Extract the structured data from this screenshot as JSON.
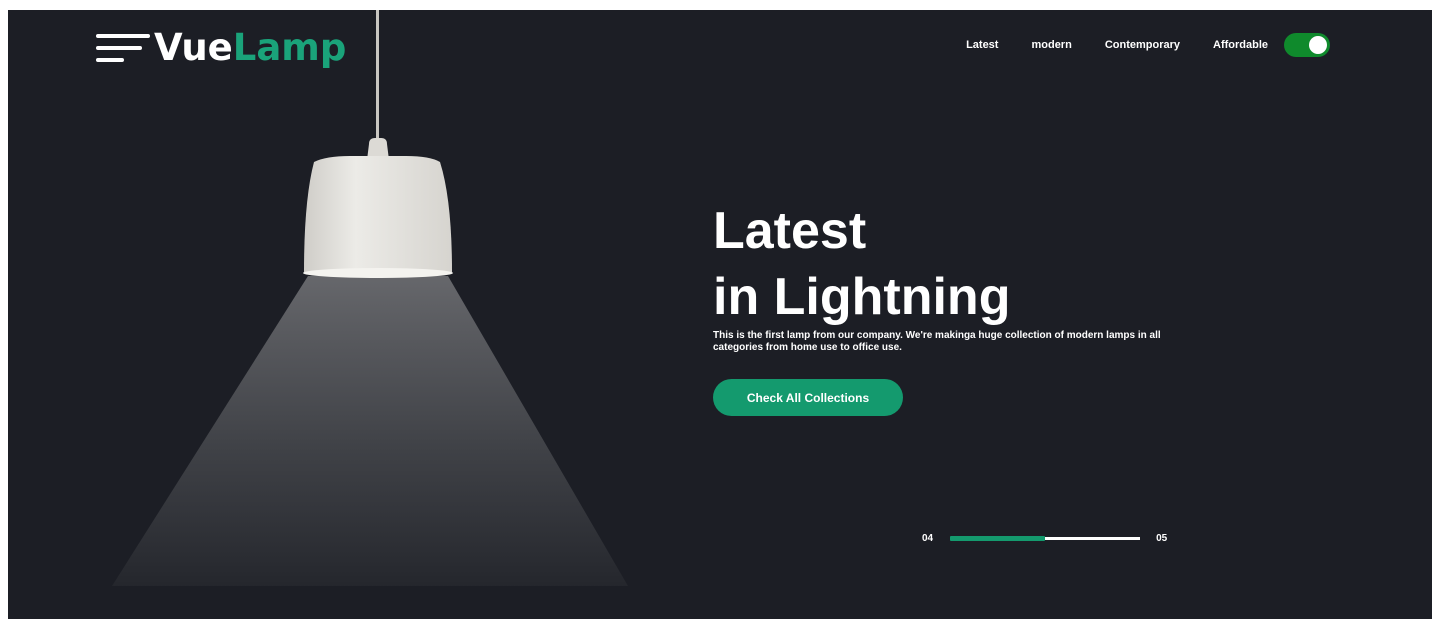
{
  "brand": {
    "logo_word_1": "Vue",
    "logo_word_2": "Lamp"
  },
  "nav": {
    "items": [
      "Latest",
      "modern",
      "Contemporary",
      "Affordable"
    ],
    "toggle_on": true
  },
  "hero": {
    "title_line_1": "Latest",
    "title_line_2": "in Lightning",
    "description": "This is the first lamp from our company. We're makinga huge collection of modern lamps in all categories from home use to office use.",
    "cta_label": "Check All Collections"
  },
  "slider": {
    "current": "04",
    "total": "05",
    "progress_fraction": 0.5
  },
  "colors": {
    "background": "#1c1e25",
    "accent": "#149a6e",
    "logo_accent": "#1aa37a",
    "toggle": "#0f8a2c",
    "text": "#ffffff",
    "lamp_shade": "#e6e4df"
  },
  "icons": {
    "menu": "hamburger-menu-icon"
  }
}
